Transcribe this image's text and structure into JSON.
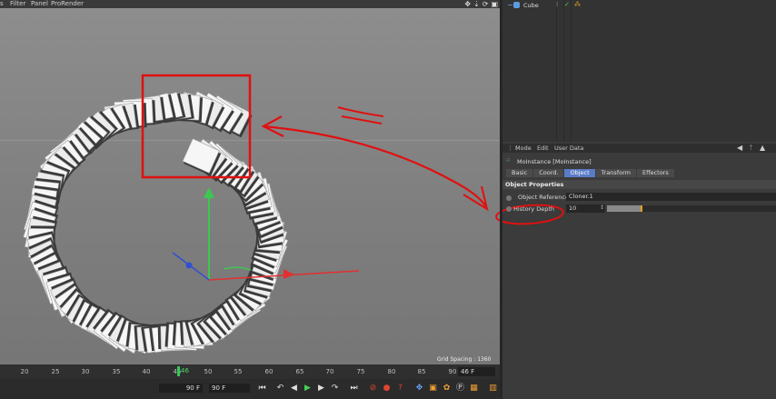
{
  "viewport": {
    "menu": [
      "s",
      "Filter",
      "Panel",
      "ProRender"
    ],
    "grid_spacing": "Grid Spacing : 1360 cm"
  },
  "timeline": {
    "ticks": [
      "20",
      "25",
      "30",
      "35",
      "40",
      "45",
      "50",
      "55",
      "60",
      "65",
      "70",
      "75",
      "80",
      "85",
      "90"
    ],
    "current_frame": "46",
    "frame_display": "46 F"
  },
  "transport": {
    "start_field": "90 F",
    "end_field": "90 F"
  },
  "object_manager": {
    "object_name": "Cube"
  },
  "attributes": {
    "menu": [
      "Mode",
      "Edit",
      "User Data"
    ],
    "title": "MoInstance [MoInstance]",
    "tabs": [
      "Basic",
      "Coord.",
      "Object",
      "Transform",
      "Effectors"
    ],
    "active_tab": "Object",
    "section": "Object Properties",
    "object_reference_label": "Object Reference",
    "object_reference_value": "Cloner.1",
    "history_depth_label": "History Depth",
    "history_depth_value": "10",
    "history_depth_fraction": 0.2
  },
  "colors": {
    "accent_tab": "#5a7bc8",
    "annotation": "#e01010",
    "playhead": "#35c95a"
  }
}
